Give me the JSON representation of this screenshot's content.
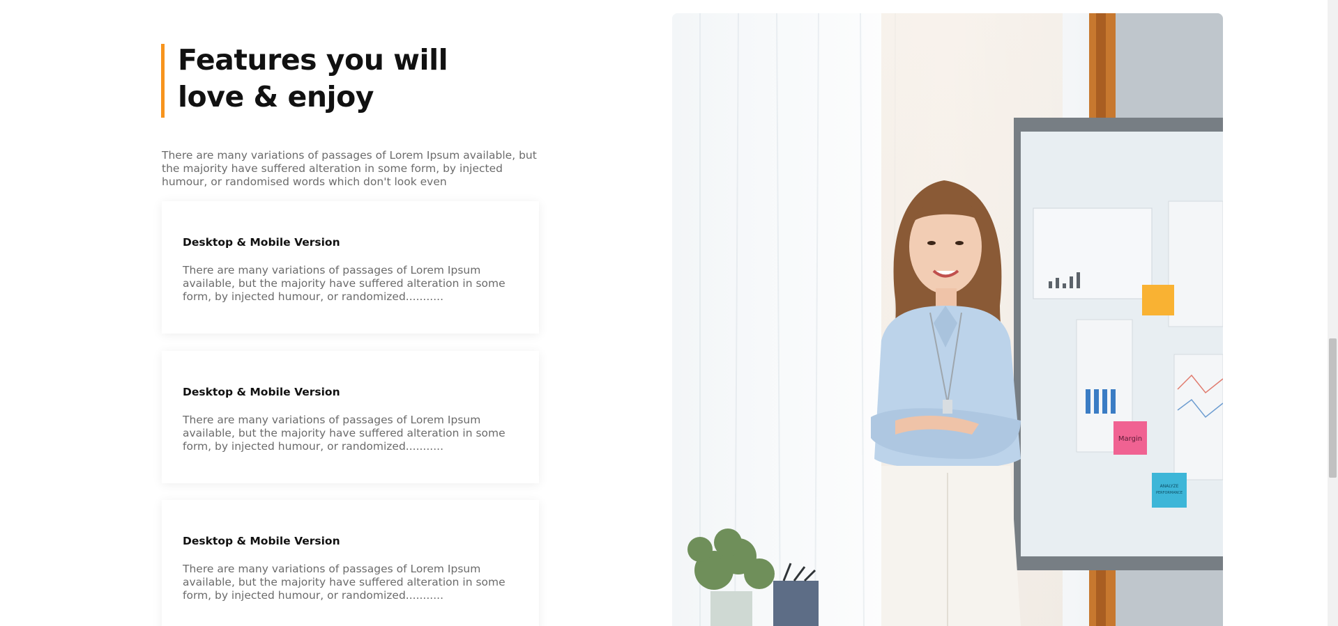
{
  "features": {
    "heading_line1": "Features you will",
    "heading_line2": "love & enjoy",
    "intro": "There are many variations of passages of Lorem Ipsum available, but the majority have suffered alteration in some form, by injected humour, or randomised words which don't look even",
    "cards": [
      {
        "title": "Desktop & Mobile Version",
        "text": "There are many variations of passages of Lorem Ipsum available, but the majority have suffered alteration in some form, by injected humour, or randomized..........."
      },
      {
        "title": "Desktop & Mobile Version",
        "text": "There are many variations of passages of Lorem Ipsum available, but the majority have suffered alteration in some form, by injected humour, or randomized..........."
      },
      {
        "title": "Desktop & Mobile Version",
        "text": "There are many variations of passages of Lorem Ipsum available, but the majority have suffered alteration in some form, by injected humour, or randomized..........."
      }
    ]
  },
  "whiteboard": {
    "sticky_notes": [
      "Margin",
      "ANALYZE PERFORMANCE"
    ]
  },
  "colors": {
    "accent": "#f7941d",
    "heading": "#111111",
    "body_text": "#6b6b6b"
  }
}
